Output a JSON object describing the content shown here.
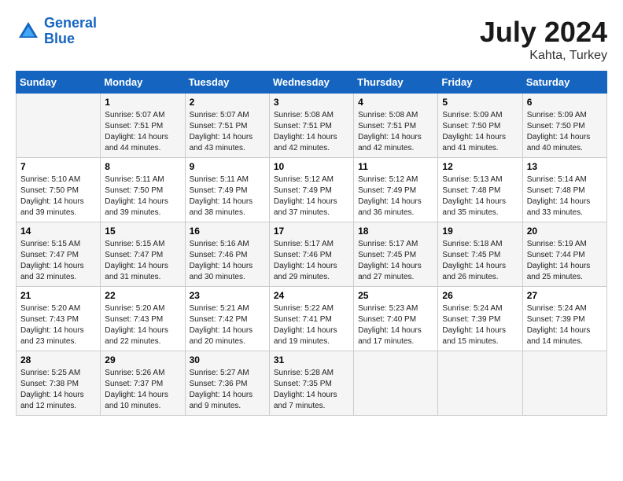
{
  "header": {
    "logo_line1": "General",
    "logo_line2": "Blue",
    "main_title": "July 2024",
    "subtitle": "Kahta, Turkey"
  },
  "calendar": {
    "days_of_week": [
      "Sunday",
      "Monday",
      "Tuesday",
      "Wednesday",
      "Thursday",
      "Friday",
      "Saturday"
    ],
    "weeks": [
      [
        {
          "day": "",
          "info": ""
        },
        {
          "day": "1",
          "info": "Sunrise: 5:07 AM\nSunset: 7:51 PM\nDaylight: 14 hours\nand 44 minutes."
        },
        {
          "day": "2",
          "info": "Sunrise: 5:07 AM\nSunset: 7:51 PM\nDaylight: 14 hours\nand 43 minutes."
        },
        {
          "day": "3",
          "info": "Sunrise: 5:08 AM\nSunset: 7:51 PM\nDaylight: 14 hours\nand 42 minutes."
        },
        {
          "day": "4",
          "info": "Sunrise: 5:08 AM\nSunset: 7:51 PM\nDaylight: 14 hours\nand 42 minutes."
        },
        {
          "day": "5",
          "info": "Sunrise: 5:09 AM\nSunset: 7:50 PM\nDaylight: 14 hours\nand 41 minutes."
        },
        {
          "day": "6",
          "info": "Sunrise: 5:09 AM\nSunset: 7:50 PM\nDaylight: 14 hours\nand 40 minutes."
        }
      ],
      [
        {
          "day": "7",
          "info": "Sunrise: 5:10 AM\nSunset: 7:50 PM\nDaylight: 14 hours\nand 39 minutes."
        },
        {
          "day": "8",
          "info": "Sunrise: 5:11 AM\nSunset: 7:50 PM\nDaylight: 14 hours\nand 39 minutes."
        },
        {
          "day": "9",
          "info": "Sunrise: 5:11 AM\nSunset: 7:49 PM\nDaylight: 14 hours\nand 38 minutes."
        },
        {
          "day": "10",
          "info": "Sunrise: 5:12 AM\nSunset: 7:49 PM\nDaylight: 14 hours\nand 37 minutes."
        },
        {
          "day": "11",
          "info": "Sunrise: 5:12 AM\nSunset: 7:49 PM\nDaylight: 14 hours\nand 36 minutes."
        },
        {
          "day": "12",
          "info": "Sunrise: 5:13 AM\nSunset: 7:48 PM\nDaylight: 14 hours\nand 35 minutes."
        },
        {
          "day": "13",
          "info": "Sunrise: 5:14 AM\nSunset: 7:48 PM\nDaylight: 14 hours\nand 33 minutes."
        }
      ],
      [
        {
          "day": "14",
          "info": "Sunrise: 5:15 AM\nSunset: 7:47 PM\nDaylight: 14 hours\nand 32 minutes."
        },
        {
          "day": "15",
          "info": "Sunrise: 5:15 AM\nSunset: 7:47 PM\nDaylight: 14 hours\nand 31 minutes."
        },
        {
          "day": "16",
          "info": "Sunrise: 5:16 AM\nSunset: 7:46 PM\nDaylight: 14 hours\nand 30 minutes."
        },
        {
          "day": "17",
          "info": "Sunrise: 5:17 AM\nSunset: 7:46 PM\nDaylight: 14 hours\nand 29 minutes."
        },
        {
          "day": "18",
          "info": "Sunrise: 5:17 AM\nSunset: 7:45 PM\nDaylight: 14 hours\nand 27 minutes."
        },
        {
          "day": "19",
          "info": "Sunrise: 5:18 AM\nSunset: 7:45 PM\nDaylight: 14 hours\nand 26 minutes."
        },
        {
          "day": "20",
          "info": "Sunrise: 5:19 AM\nSunset: 7:44 PM\nDaylight: 14 hours\nand 25 minutes."
        }
      ],
      [
        {
          "day": "21",
          "info": "Sunrise: 5:20 AM\nSunset: 7:43 PM\nDaylight: 14 hours\nand 23 minutes."
        },
        {
          "day": "22",
          "info": "Sunrise: 5:20 AM\nSunset: 7:43 PM\nDaylight: 14 hours\nand 22 minutes."
        },
        {
          "day": "23",
          "info": "Sunrise: 5:21 AM\nSunset: 7:42 PM\nDaylight: 14 hours\nand 20 minutes."
        },
        {
          "day": "24",
          "info": "Sunrise: 5:22 AM\nSunset: 7:41 PM\nDaylight: 14 hours\nand 19 minutes."
        },
        {
          "day": "25",
          "info": "Sunrise: 5:23 AM\nSunset: 7:40 PM\nDaylight: 14 hours\nand 17 minutes."
        },
        {
          "day": "26",
          "info": "Sunrise: 5:24 AM\nSunset: 7:39 PM\nDaylight: 14 hours\nand 15 minutes."
        },
        {
          "day": "27",
          "info": "Sunrise: 5:24 AM\nSunset: 7:39 PM\nDaylight: 14 hours\nand 14 minutes."
        }
      ],
      [
        {
          "day": "28",
          "info": "Sunrise: 5:25 AM\nSunset: 7:38 PM\nDaylight: 14 hours\nand 12 minutes."
        },
        {
          "day": "29",
          "info": "Sunrise: 5:26 AM\nSunset: 7:37 PM\nDaylight: 14 hours\nand 10 minutes."
        },
        {
          "day": "30",
          "info": "Sunrise: 5:27 AM\nSunset: 7:36 PM\nDaylight: 14 hours\nand 9 minutes."
        },
        {
          "day": "31",
          "info": "Sunrise: 5:28 AM\nSunset: 7:35 PM\nDaylight: 14 hours\nand 7 minutes."
        },
        {
          "day": "",
          "info": ""
        },
        {
          "day": "",
          "info": ""
        },
        {
          "day": "",
          "info": ""
        }
      ]
    ]
  }
}
